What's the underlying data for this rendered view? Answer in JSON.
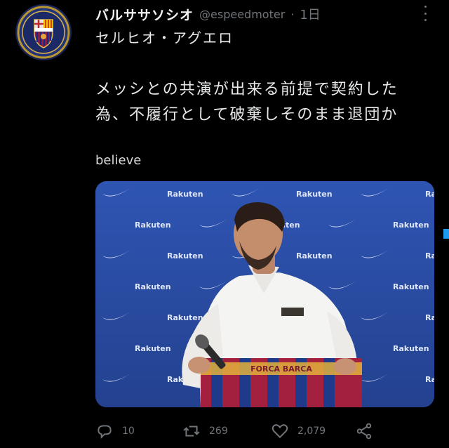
{
  "tweet": {
    "display_name": "バルササソシオ",
    "handle": "@espeedmoter",
    "separator": "·",
    "time": "1日",
    "subtitle": "セルヒオ・アグエロ",
    "body_lines": [
      "メッシとの共演が出来る前提で契約した",
      "為、不履行として破棄しそのまま退団か"
    ],
    "tag_word": "believe"
  },
  "media": {
    "backdrop_text": "Rakuten",
    "scarf_text": "FORCA BARCA"
  },
  "actions": {
    "reply_count": "10",
    "retweet_count": "269",
    "like_count": "2,079"
  },
  "colors": {
    "background": "#000000",
    "text": "#e7e9ea",
    "muted": "#71767b",
    "backdrop_blue": "#2c4fa8",
    "accent": "#1d9bf0"
  },
  "icons": [
    "crest-icon",
    "more-icon",
    "reply-icon",
    "retweet-icon",
    "like-icon",
    "share-icon"
  ]
}
